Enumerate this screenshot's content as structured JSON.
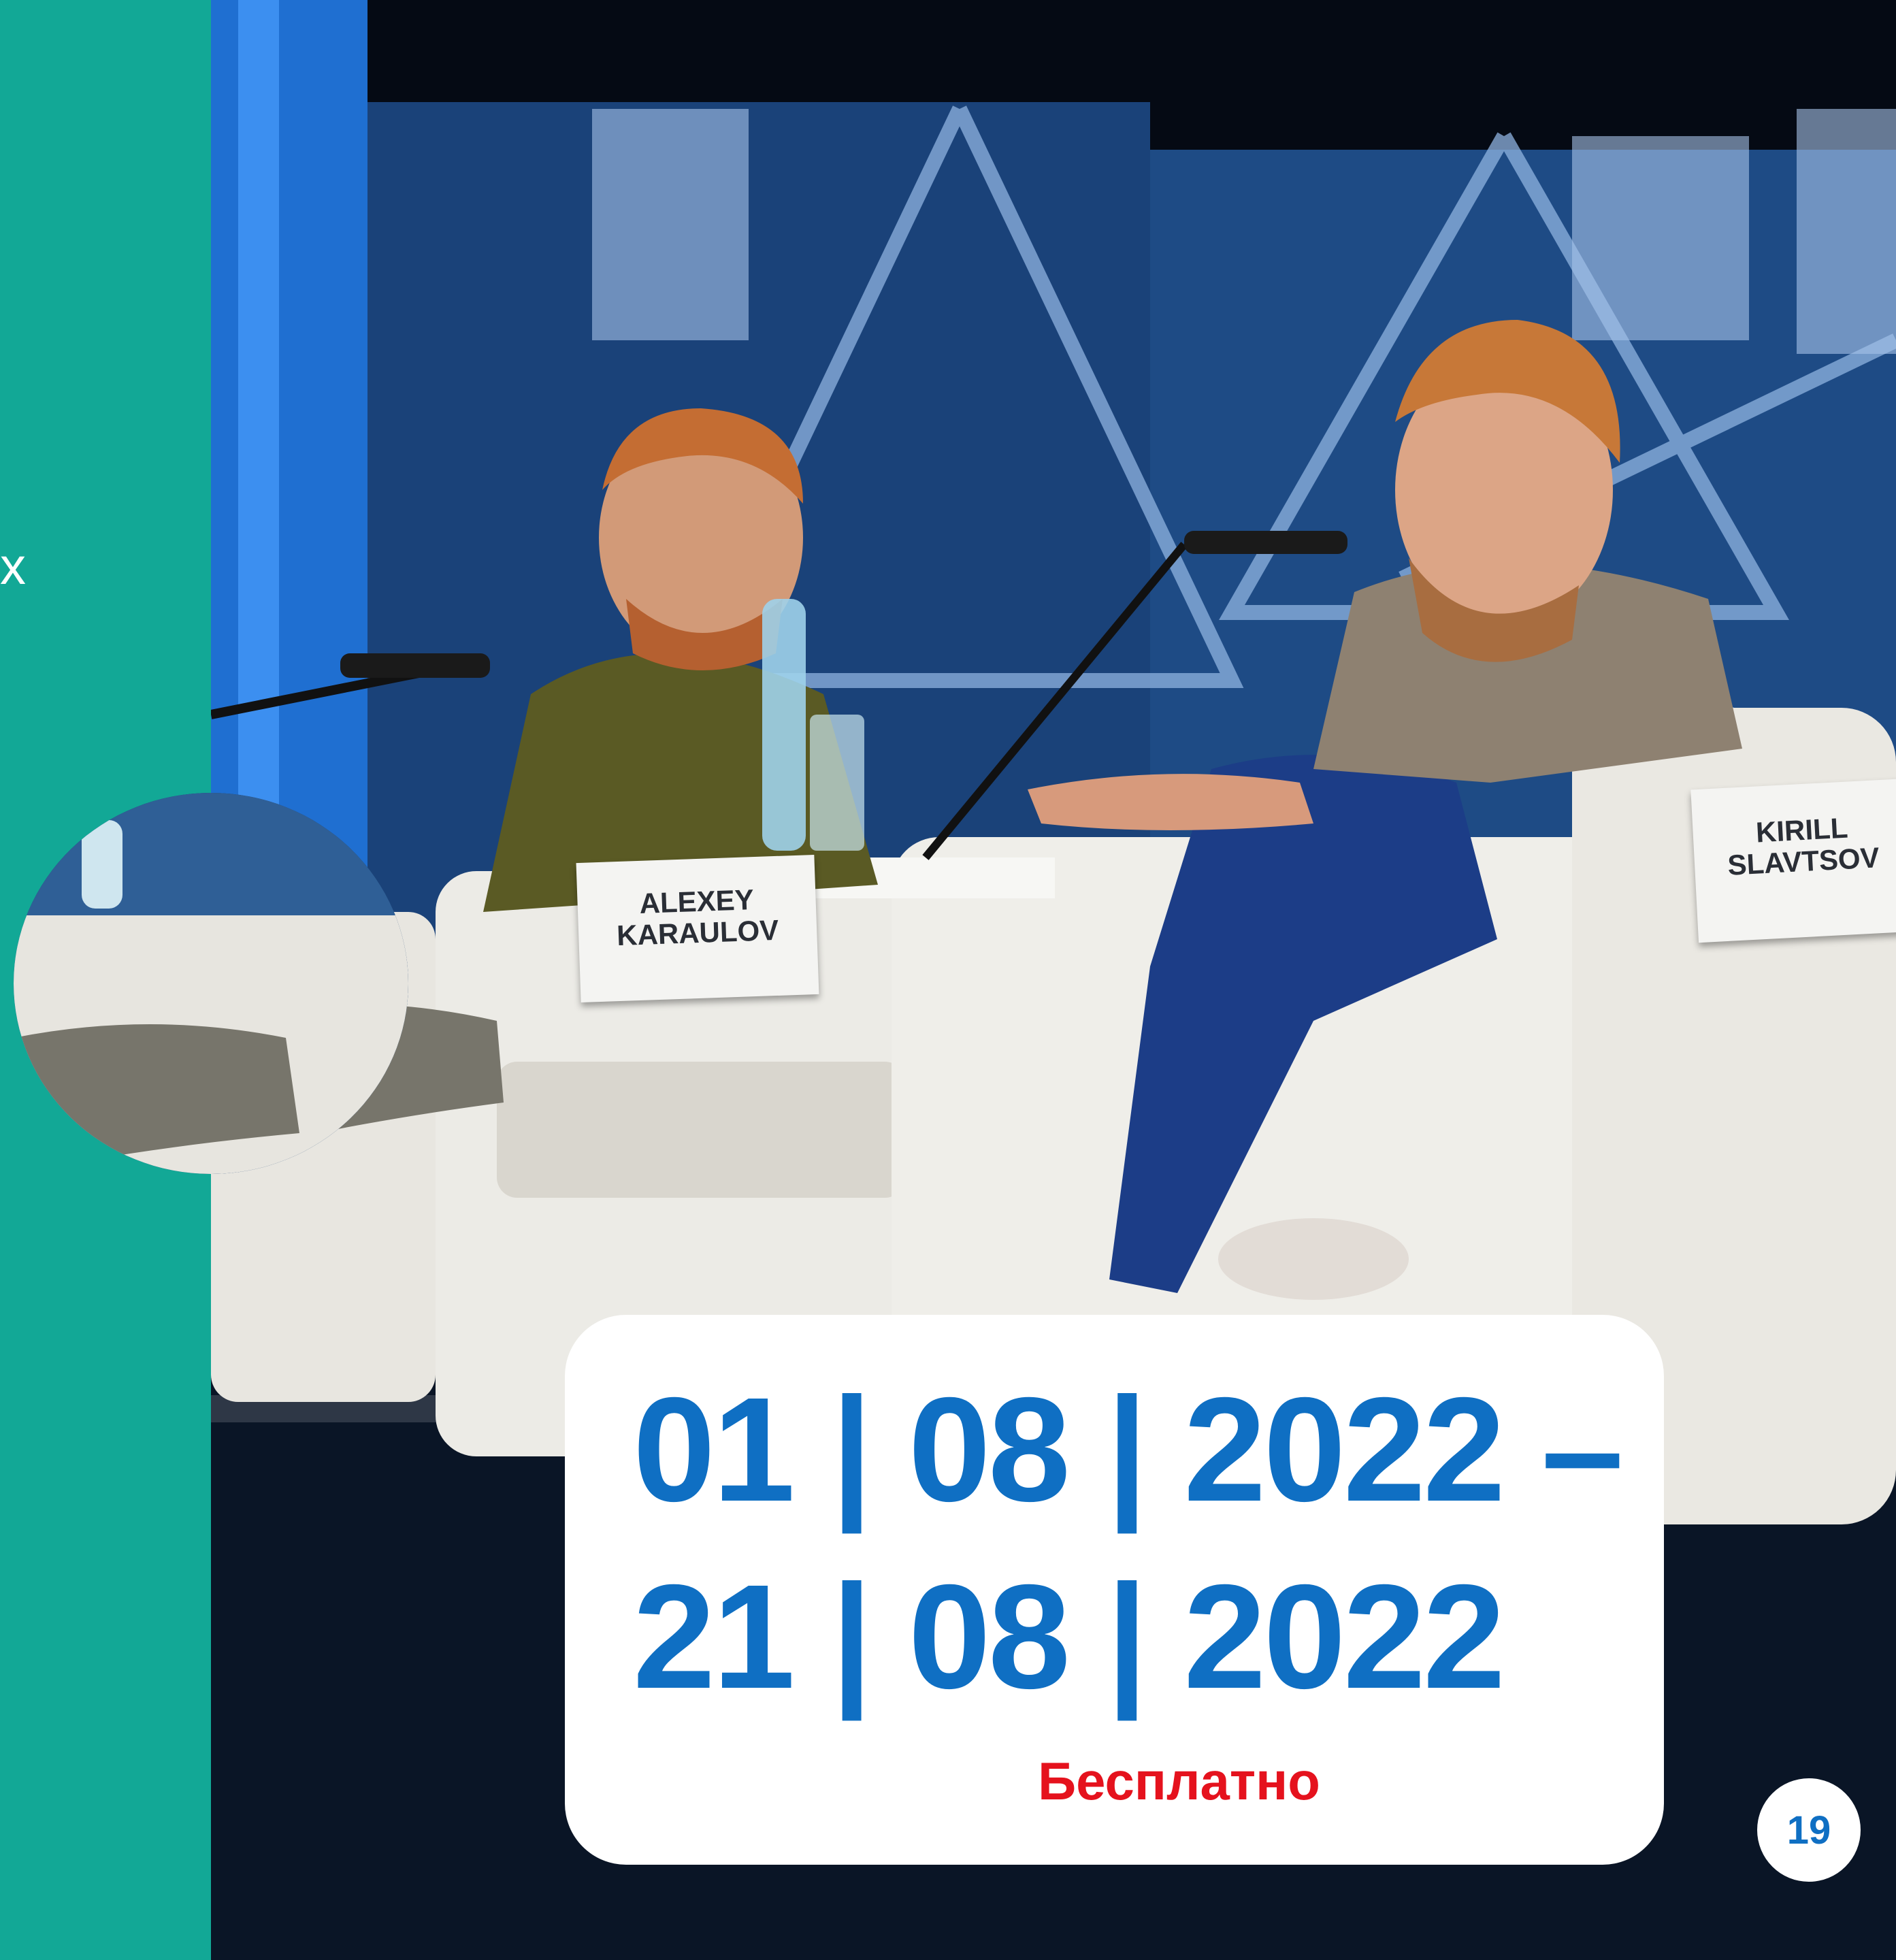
{
  "sidebar": {
    "text_fragment": "х"
  },
  "name_plates": [
    {
      "first": "ALEXEY",
      "last": "KARAULOV"
    },
    {
      "first": "KIRILL",
      "last": "SLAVTSOV"
    }
  ],
  "event": {
    "date_line_1": "01 | 08 | 2022 –",
    "date_line_2": "21 | 08 | 2022",
    "price": "Бесплатно"
  },
  "page": {
    "number": "19"
  },
  "colors": {
    "teal": "#12a896",
    "date_blue": "#0f6fc3",
    "price_red": "#e5121d"
  }
}
